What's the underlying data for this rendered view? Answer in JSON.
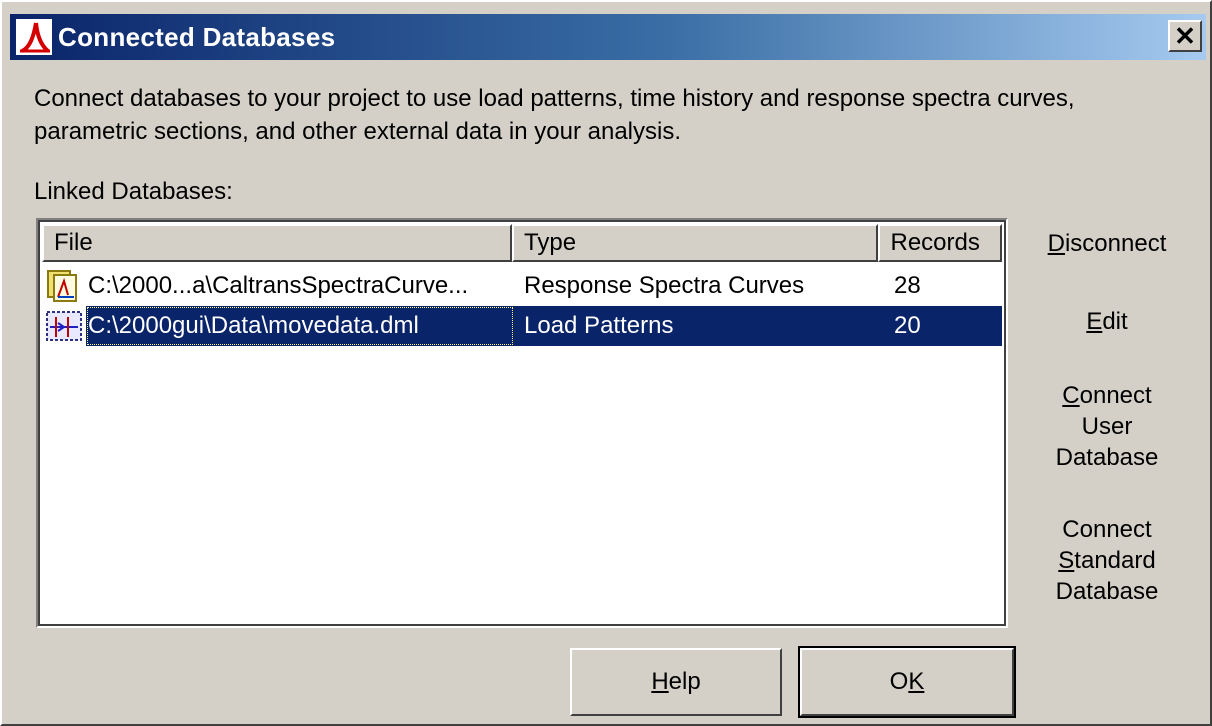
{
  "window": {
    "title": "Connected Databases",
    "close_glyph": "✕"
  },
  "description": {
    "line1": "Connect databases to your project to use load patterns, time history and response spectra curves,",
    "line2": "parametric sections, and other external data in your analysis."
  },
  "linked_label": "Linked Databases:",
  "table": {
    "columns": [
      "File",
      "Type",
      "Records"
    ],
    "rows": [
      {
        "icon": "spectra-curve-file-icon",
        "file": "C:\\2000...a\\CaltransSpectraCurve...",
        "type": "Response Spectra Curves",
        "records": "28",
        "selected": false
      },
      {
        "icon": "load-pattern-file-icon",
        "file": "C:\\2000gui\\Data\\movedata.dml",
        "type": "Load Patterns",
        "records": "20",
        "selected": true
      }
    ]
  },
  "side_buttons": {
    "disconnect": {
      "mnemonic": "D",
      "rest": "isconnect"
    },
    "edit": {
      "mnemonic": "E",
      "rest": "dit"
    },
    "connect_user": {
      "line1_mnemonic": "C",
      "line1_rest": "onnect",
      "line2": "User",
      "line3": "Database"
    },
    "connect_standard": {
      "line1": "Connect",
      "line2_mnemonic": "S",
      "line2_rest": "tandard",
      "line3": "Database"
    }
  },
  "buttons": {
    "help": {
      "mnemonic": "H",
      "rest": "elp"
    },
    "ok": {
      "prefix": "O",
      "mnemonic": "K"
    }
  },
  "colors": {
    "title_gradient_start": "#0a246a",
    "selection": "#0a246a",
    "dialog_face": "#d4d0c8"
  }
}
